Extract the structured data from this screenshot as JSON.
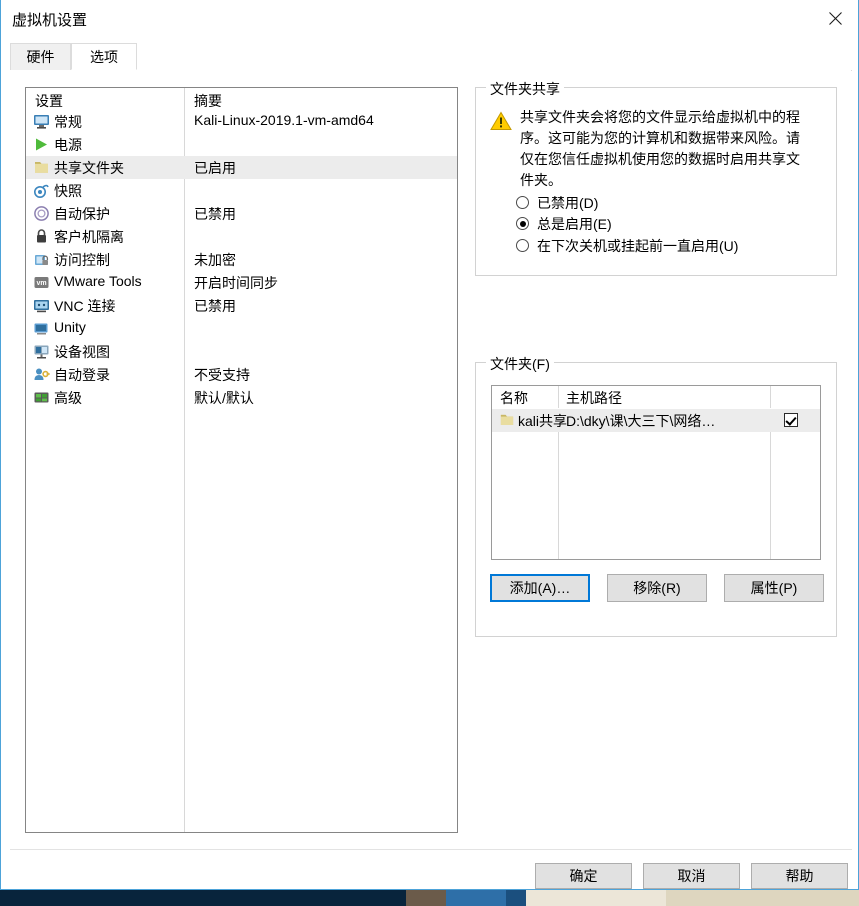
{
  "window": {
    "title": "虚拟机设置",
    "close_icon": "close-icon"
  },
  "tabs": [
    {
      "label": "硬件",
      "active": false
    },
    {
      "label": "选项",
      "active": true
    }
  ],
  "settings_list": {
    "columns": {
      "name": "设置",
      "summary": "摘要"
    },
    "rows": [
      {
        "icon": "monitor-icon",
        "label": "常规",
        "summary": "Kali-Linux-2019.1-vm-amd64",
        "selected": false
      },
      {
        "icon": "power-play-icon",
        "label": "电源",
        "summary": "",
        "selected": false
      },
      {
        "icon": "folder-icon",
        "label": "共享文件夹",
        "summary": "已启用",
        "selected": true
      },
      {
        "icon": "camera-icon",
        "label": "快照",
        "summary": "",
        "selected": false
      },
      {
        "icon": "autoprotect-icon",
        "label": "自动保护",
        "summary": "已禁用",
        "selected": false
      },
      {
        "icon": "lock-icon",
        "label": "客户机隔离",
        "summary": "",
        "selected": false
      },
      {
        "icon": "access-control-icon",
        "label": "访问控制",
        "summary": "未加密",
        "selected": false
      },
      {
        "icon": "vmware-tools-icon",
        "label": "VMware Tools",
        "summary": "开启时间同步",
        "selected": false
      },
      {
        "icon": "vnc-icon",
        "label": "VNC 连接",
        "summary": "已禁用",
        "selected": false
      },
      {
        "icon": "unity-icon",
        "label": "Unity",
        "summary": "",
        "selected": false
      },
      {
        "icon": "device-view-icon",
        "label": "设备视图",
        "summary": "",
        "selected": false
      },
      {
        "icon": "auto-login-icon",
        "label": "自动登录",
        "summary": "不受支持",
        "selected": false
      },
      {
        "icon": "advanced-icon",
        "label": "高级",
        "summary": "默认/默认",
        "selected": false
      }
    ]
  },
  "sharing_group": {
    "title": "文件夹共享",
    "warning_icon": "warning-icon",
    "warning_text": "共享文件夹会将您的文件显示给虚拟机中的程序。这可能为您的计算机和数据带来风险。请仅在您信任虚拟机使用您的数据时启用共享文件夹。",
    "options": [
      {
        "label": "已禁用(D)",
        "checked": false
      },
      {
        "label": "总是启用(E)",
        "checked": true
      },
      {
        "label": "在下次关机或挂起前一直启用(U)",
        "checked": false
      }
    ]
  },
  "folders_group": {
    "title": "文件夹(F)",
    "columns": {
      "name": "名称",
      "host_path": "主机路径"
    },
    "rows": [
      {
        "icon": "folder-icon",
        "name": "kali共享",
        "host_path": "D:\\dky\\课\\大三下\\网络…",
        "enabled": true
      }
    ],
    "buttons": {
      "add": "添加(A)…",
      "remove": "移除(R)",
      "properties": "属性(P)"
    }
  },
  "footer": {
    "ok": "确定",
    "cancel": "取消",
    "help": "帮助"
  },
  "colors": {
    "accent": "#0078d7",
    "window_border": "#4da3d9",
    "selection": "#ececec",
    "button_face": "#e1e1e1",
    "warning": "#ffcc00"
  }
}
